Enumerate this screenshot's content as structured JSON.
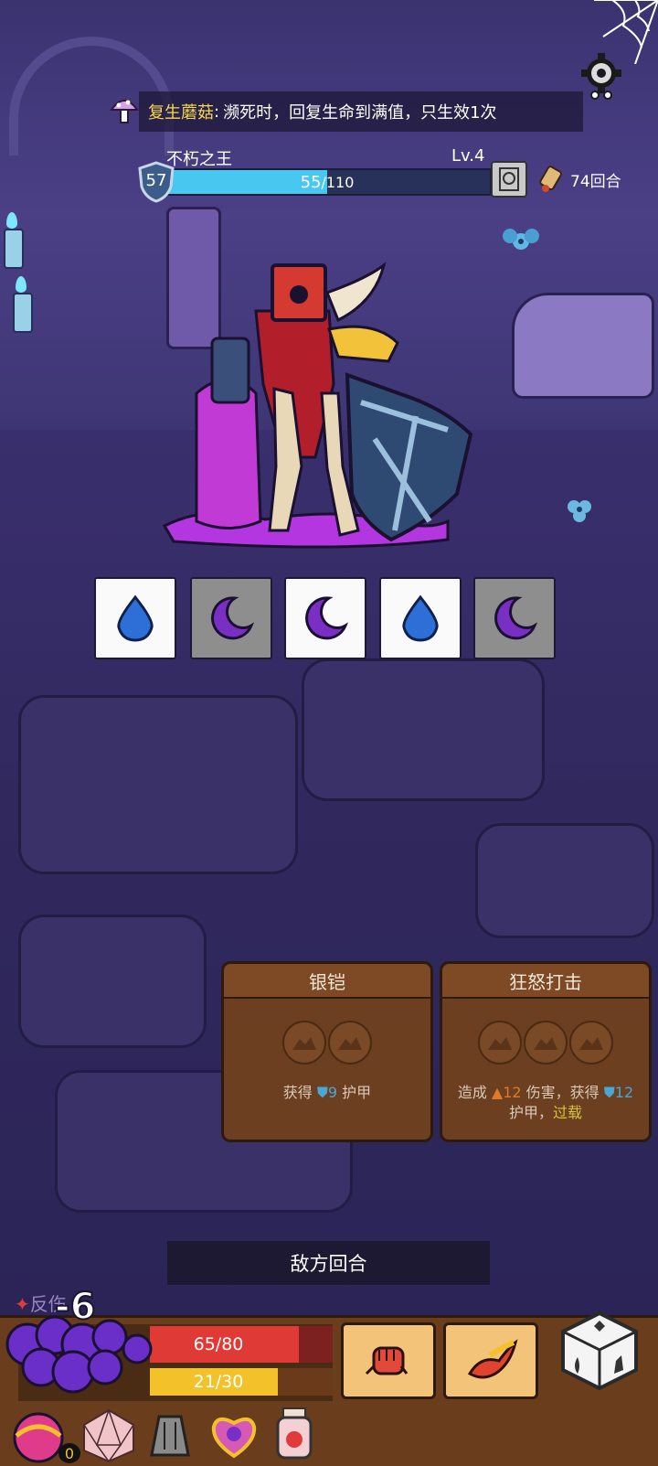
{
  "relic_notice": {
    "name": "复生蘑菇",
    "separator": ":",
    "effect": "濒死时，回复生命到满值，只生效1次"
  },
  "enemy": {
    "name": "不朽之王",
    "level": "Lv.4",
    "shield": "57",
    "hp_current": "55",
    "hp_max": "/110",
    "hp_fraction": 0.5
  },
  "rounds": {
    "label": "74回合"
  },
  "intents": [
    {
      "type": "water",
      "icon": "water-drop-icon",
      "bg": "white"
    },
    {
      "type": "moon",
      "icon": "crescent-moon-icon",
      "bg": "gray"
    },
    {
      "type": "moon",
      "icon": "crescent-moon-icon",
      "bg": "white"
    },
    {
      "type": "water",
      "icon": "water-drop-icon",
      "bg": "white"
    },
    {
      "type": "moon",
      "icon": "crescent-moon-icon",
      "bg": "gray"
    }
  ],
  "skills": [
    {
      "title": "银铠",
      "slots": 2,
      "desc_pre": "获得 ",
      "armor": "9",
      "desc_post": " 护甲"
    },
    {
      "title": "狂怒打击",
      "slots": 3,
      "desc_pre": "造成 ",
      "damage": "12",
      "desc_mid": " 伤害，获得 ",
      "armor": "12",
      "desc_post": "护甲，",
      "keyword": "过载"
    }
  ],
  "turn_banner": "敌方回合",
  "player": {
    "counter_label": "反伤",
    "damage_popup": "-6",
    "hp": "65/80",
    "hp_fraction": 0.8125,
    "energy": "21/30",
    "energy_fraction": 0.7,
    "gold": "0"
  },
  "colors": {
    "water": "#2d6fd6",
    "moon": "#7a2fc4",
    "hp_bar": "#48c8f0",
    "player_hp": "#e03a36",
    "player_energy": "#f3c12a"
  }
}
